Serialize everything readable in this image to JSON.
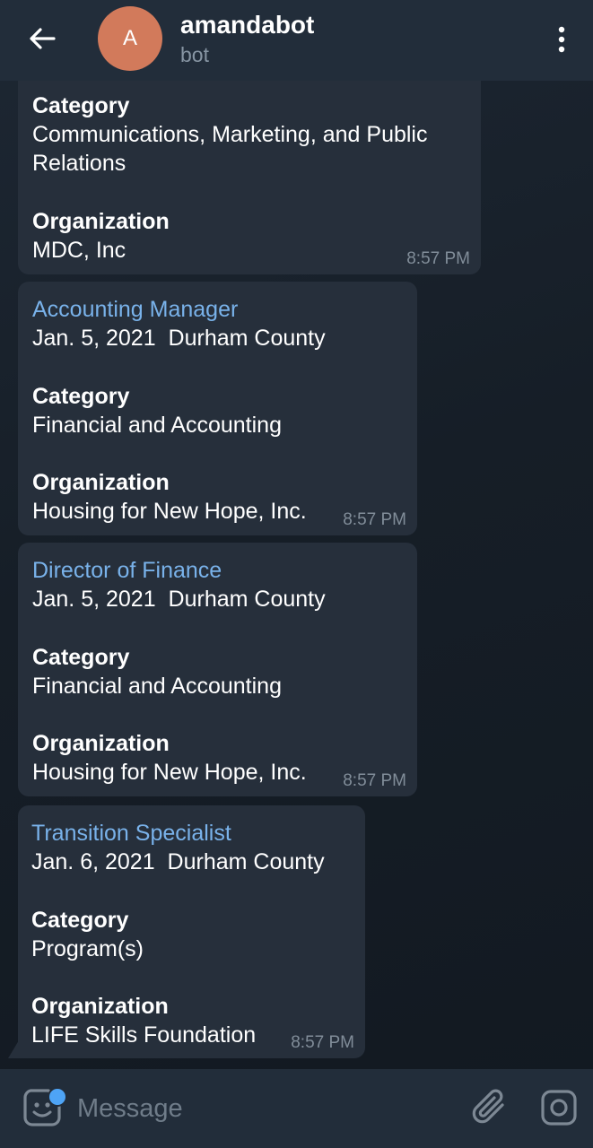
{
  "header": {
    "back_icon": "arrow-left-icon",
    "avatar_letter": "A",
    "avatar_color": "#d27a5b",
    "title": "amandabot",
    "subtitle": "bot",
    "menu_icon": "more-vertical-icon"
  },
  "messages": [
    {
      "category_label": "Category",
      "category_line1": "Communications, Marketing, and Public",
      "category_line2": "Relations",
      "organization_label": "Organization",
      "organization": "MDC, Inc",
      "time": "8:57 PM"
    },
    {
      "job_title": "Accounting Manager",
      "date": "Jan. 5, 2021",
      "location": "Durham County",
      "category_label": "Category",
      "category": "Financial and Accounting",
      "organization_label": "Organization",
      "organization": "Housing for New Hope, Inc.",
      "time": "8:57 PM"
    },
    {
      "job_title": "Director of Finance",
      "date": "Jan. 5, 2021",
      "location": "Durham County",
      "category_label": "Category",
      "category": "Financial and Accounting",
      "organization_label": "Organization",
      "organization": "Housing for New Hope, Inc.",
      "time": "8:57 PM"
    },
    {
      "job_title": "Transition Specialist",
      "date": "Jan. 6, 2021",
      "location": "Durham County",
      "category_label": "Category",
      "category": "Program(s)",
      "organization_label": "Organization",
      "organization": "LIFE Skills Foundation",
      "time": "8:57 PM"
    }
  ],
  "composer": {
    "emoji_icon": "emoji-sticker-icon",
    "placeholder": "Message",
    "attach_icon": "paperclip-icon",
    "camera_icon": "camera-icon"
  },
  "colors": {
    "header_bg": "#222d3a",
    "bubble_bg": "#262f3b",
    "link": "#79b2ea",
    "accent_dot": "#4ea4f6"
  }
}
